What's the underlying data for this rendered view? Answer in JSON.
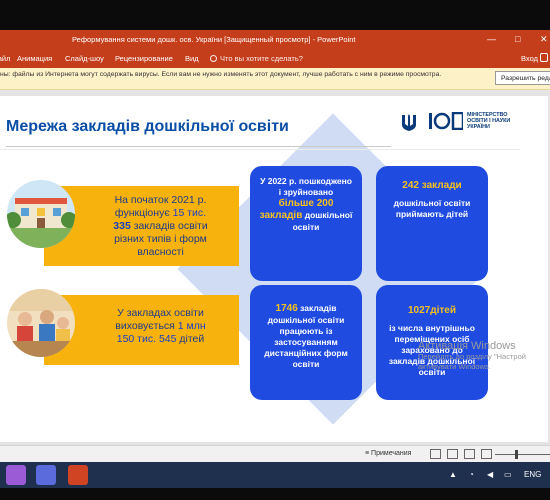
{
  "window": {
    "title": "Реформування системи дошк. осв. України [Защищенный просмотр] - PowerPoint",
    "minimize_glyph": "—",
    "maximize_glyph": "□",
    "close_glyph": "✕"
  },
  "ribbon": {
    "tabs": [
      "Файл",
      "Анимация",
      "Слайд-шоу",
      "Рецензирование",
      "Вид"
    ],
    "tell_me": "Что вы хотите сделать?",
    "login": "Вход"
  },
  "protected_view": {
    "message": "ны: файлы из Интернета могут содержать вирусы. Если вам не нужно изменять этот документ, лучше работать с ним в режиме просмотра.",
    "enable_button": "Разрешить редактирование"
  },
  "slide": {
    "title": "Мережа закладів дошкільної освіти",
    "ministry": "МІНІСТЕРСТВО ОСВІТИ І НАУКИ УКРАЇНИ",
    "left1": {
      "p1": "На початок 2021 р.",
      "p2": "функціонує",
      "n1": "15 тис.",
      "n2": "335",
      "p3": "закладів освіти",
      "p4": "різних типів і форм",
      "p5": "власності"
    },
    "left2": {
      "p1": "У закладах освіти",
      "p2": "виховується",
      "n1": "1 млн",
      "n2": "150 тис. 545",
      "p3": "дітей"
    },
    "box1": {
      "p1": "У 2022 р. пошкоджено",
      "p2": "і зруйновано",
      "big": "більше 200",
      "p3": "закладів",
      "p4": "дошкільної",
      "p5": "освіти"
    },
    "box2": {
      "big": "242 заклади",
      "p1": "дошкільної освіти",
      "p2": "приймають дітей"
    },
    "box3": {
      "big": "1746",
      "p1": "закладів",
      "p2": "дошкільної освіти",
      "p3": "працюють із",
      "p4": "застосуванням",
      "p5": "дистанційних форм",
      "p6": "освіти"
    },
    "box4": {
      "big": "1027дітей",
      "p1": "із числа  внутрішньо",
      "p2": "переміщених осіб",
      "p3": "зараховано до",
      "p4": "закладів дошкільної",
      "p5": "освіти"
    }
  },
  "activation": {
    "title": "Активація Windows",
    "line1": "Перейдіть до розділу \"Настрой",
    "line2": "активувати Windows."
  },
  "status": {
    "notes": "Примечания"
  },
  "taskbar": {
    "lang": "ENG"
  },
  "colors": {
    "accent": "#c43e1c",
    "yellow": "#f7b20d",
    "blue": "#1f4be0",
    "title_blue": "#0a4ea6"
  }
}
